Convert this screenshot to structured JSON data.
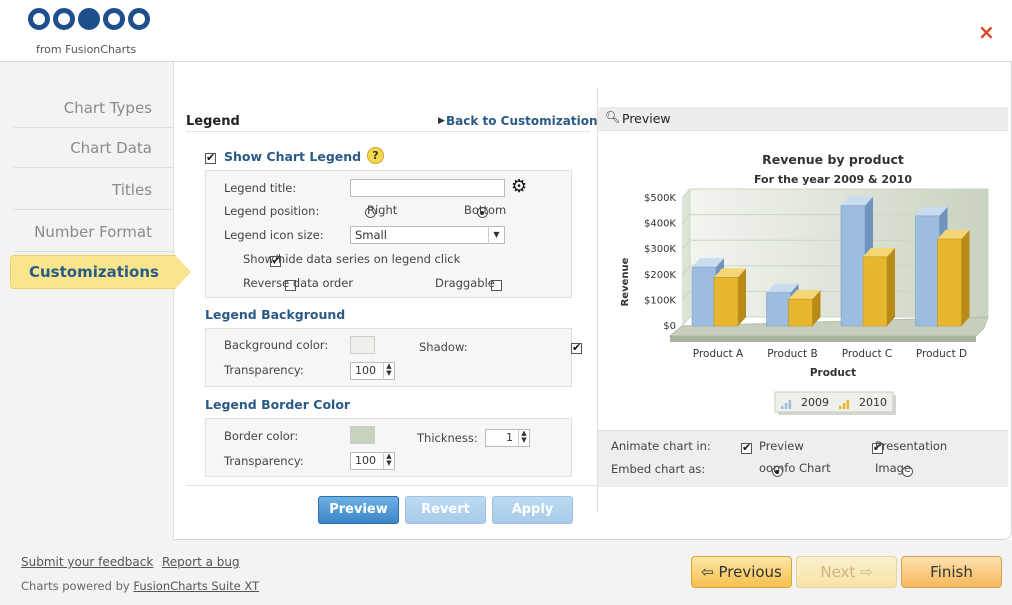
{
  "header": {
    "brand": "oomfo",
    "brand_sub": "from FusionCharts",
    "close_label": "×"
  },
  "sidebar": {
    "items": [
      {
        "label": "Chart Types"
      },
      {
        "label": "Chart Data"
      },
      {
        "label": "Titles"
      },
      {
        "label": "Number Format"
      }
    ],
    "active": "Customizations"
  },
  "panel": {
    "title": "Legend",
    "back_link": "Back to Customization",
    "show_legend_label": "Show Chart Legend",
    "help_icon": "?",
    "legend_title_label": "Legend title:",
    "legend_title_value": "",
    "legend_position_label": "Legend position:",
    "position_right": "Right",
    "position_bottom": "Bottom",
    "icon_size_label": "Legend icon size:",
    "icon_size_value": "Small",
    "showhide_label": "Show/hide data series on legend click",
    "reverse_label": "Reverse data order",
    "draggable_label": "Draggable",
    "bg_section": "Legend Background",
    "bg_color_label": "Background color:",
    "bg_color": "#efefeb",
    "shadow_label": "Shadow:",
    "bg_transparency_label": "Transparency:",
    "bg_transparency": "100",
    "border_section": "Legend Border Color",
    "border_color_label": "Border color:",
    "border_color": "#c6d2bd",
    "thickness_label": "Thickness:",
    "thickness": "1",
    "border_transparency_label": "Transparency:",
    "border_transparency": "100",
    "btn_preview": "Preview",
    "btn_revert": "Revert",
    "btn_apply": "Apply"
  },
  "preview": {
    "header": "Preview",
    "animate_label": "Animate chart in:",
    "animate_preview": "Preview",
    "animate_presentation": "Presentation",
    "embed_label": "Embed chart as:",
    "embed_oomfo": "oomfo Chart",
    "embed_image": "Image"
  },
  "chart_data": {
    "type": "bar",
    "title": "Revenue by product",
    "subtitle": "For the year 2009 & 2010",
    "xlabel": "Product",
    "ylabel": "Revenue",
    "categories": [
      "Product A",
      "Product B",
      "Product C",
      "Product D"
    ],
    "series": [
      {
        "name": "2009",
        "values": [
          230000,
          130000,
          470000,
          430000
        ],
        "color": "#9dbde0"
      },
      {
        "name": "2010",
        "values": [
          190000,
          105000,
          270000,
          340000
        ],
        "color": "#e8b730"
      }
    ],
    "ylim": [
      0,
      500000
    ],
    "yticks": [
      "$0",
      "$100K",
      "$200K",
      "$300K",
      "$400K",
      "$500K"
    ],
    "legend_position": "bottom"
  },
  "footer": {
    "feedback": "Submit your feedback",
    "bug": "Report a bug",
    "powered_prefix": "Charts powered by",
    "powered_link": "FusionCharts Suite XT",
    "previous": "Previous",
    "next": "Next",
    "finish": "Finish"
  }
}
